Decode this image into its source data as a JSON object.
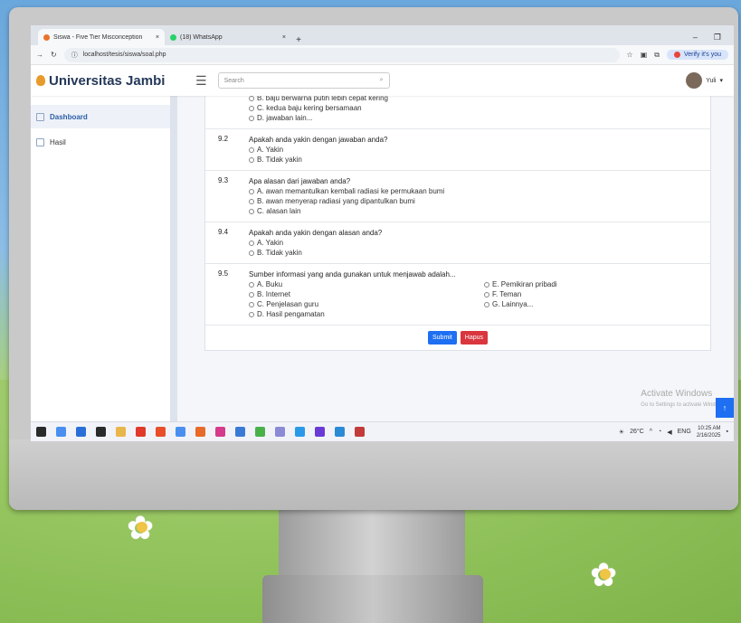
{
  "browser": {
    "tabs": [
      {
        "label": "Siswa - Five Tier Misconception",
        "active": true,
        "favicon_color": "#e8732a"
      },
      {
        "label": "(18) WhatsApp",
        "active": false,
        "favicon_color": "#25d366"
      }
    ],
    "close_glyph": "×",
    "new_tab_glyph": "+",
    "url": "localhost/tesis/siswa/soal.php",
    "verify_label": "Verify it's you"
  },
  "topnav": {
    "brand": "Universitas Jambi",
    "search_placeholder": "Search",
    "user_name": "Yuli"
  },
  "sidebar": {
    "items": [
      {
        "label": "Dashboard",
        "active": true
      },
      {
        "label": "Hasil",
        "active": false
      }
    ]
  },
  "questions": {
    "partial_options": [
      "B. baju berwarna putih lebih cepat kering",
      "C. kedua baju kering bersamaan",
      "D. jawaban lain..."
    ],
    "q92": {
      "num": "9.2",
      "text": "Apakah anda yakin dengan jawaban anda?",
      "options": [
        "A. Yakin",
        "B. Tidak yakin"
      ]
    },
    "q93": {
      "num": "9.3",
      "text": "Apa alasan dari jawaban anda?",
      "options": [
        "A. awan memantulkan kembali radiasi ke permukaan bumi",
        "B. awan menyerap radiasi yang dipantulkan bumi",
        "C. alasan lain"
      ]
    },
    "q94": {
      "num": "9.4",
      "text": "Apakah anda yakin dengan alasan anda?",
      "options": [
        "A. Yakin",
        "B. Tidak yakin"
      ]
    },
    "q95": {
      "num": "9.5",
      "text": "Sumber informasi yang anda gunakan untuk menjawab adalah...",
      "options_left": [
        "A. Buku",
        "B. Internet",
        "C. Penjelasan guru",
        "D. Hasil pengamatan"
      ],
      "options_right": [
        "E. Pemikiran pribadi",
        "F. Teman",
        "G. Lainnya..."
      ]
    }
  },
  "actions": {
    "submit": "Submit",
    "delete": "Hapus",
    "scroll_top": "↑"
  },
  "watermark": {
    "title": "Activate Windows",
    "subtitle": "Go to Settings to activate Windows."
  },
  "taskbar": {
    "weather": "26°C",
    "lang": "ENG",
    "time": "10:25 AM",
    "date": "2/16/2025",
    "icon_colors": [
      "#2a2a2a",
      "#4a8ff0",
      "#2a6fd6",
      "#2a2a2a",
      "#e8b64a",
      "#e03a2a",
      "#e84e2a",
      "#4a8ff0",
      "#e86a2a",
      "#d63a8a",
      "#3a7ad6",
      "#4ab04a",
      "#8a8ad6",
      "#2a9ae8",
      "#6a3ad6",
      "#2a8ad6",
      "#c43a3a"
    ]
  }
}
